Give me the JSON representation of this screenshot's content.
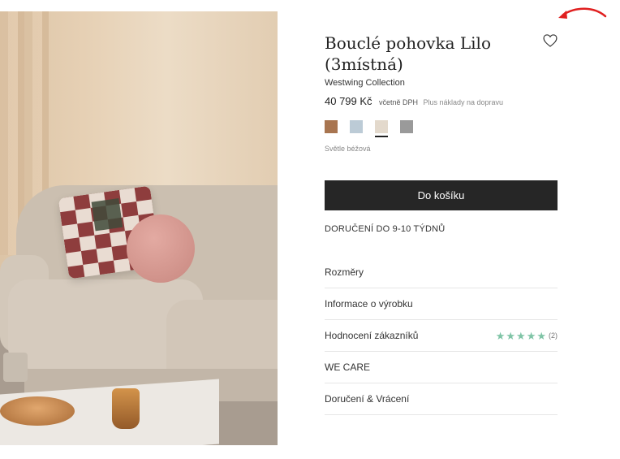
{
  "product": {
    "title": "Bouclé pohovka Lilo (3místná)",
    "brand": "Westwing Collection",
    "price": "40 799 Kč",
    "vat_note": "včetně DPH",
    "shipping_note": "Plus náklady na dopravu",
    "selected_color": "Světle béžová",
    "swatches": [
      {
        "name": "brown",
        "color": "#a87550"
      },
      {
        "name": "light-blue",
        "color": "#bccbd6"
      },
      {
        "name": "light-beige",
        "color": "#e3d9cc",
        "selected": true
      },
      {
        "name": "grey",
        "color": "#9a9a9a"
      }
    ]
  },
  "actions": {
    "add_to_cart": "Do košíku"
  },
  "delivery": "DORUČENÍ DO 9-10 TÝDNŮ",
  "accordion": [
    {
      "label": "Rozměry"
    },
    {
      "label": "Informace o výrobku"
    },
    {
      "label": "Hodnocení zákazníků",
      "rating": 5,
      "review_count": "(2)"
    },
    {
      "label": "WE CARE"
    },
    {
      "label": "Doručení & Vrácení"
    }
  ],
  "colors": {
    "button_bg": "#262626",
    "star": "#7fc4a6",
    "annotation_arrow": "#e02020"
  },
  "icons": [
    "heart-icon",
    "star-icon",
    "arrow-annotation"
  ]
}
